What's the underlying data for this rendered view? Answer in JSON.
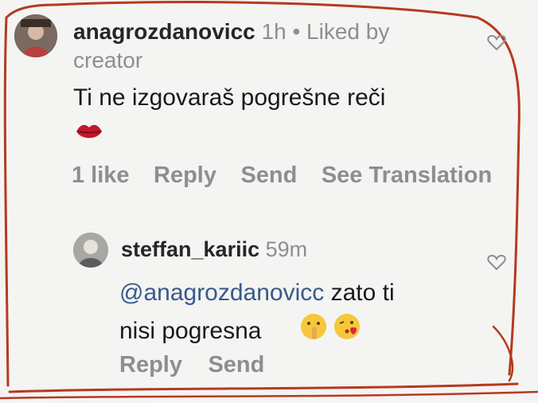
{
  "comments": [
    {
      "username": "anagrozdanovicc",
      "time": "1h",
      "separator": "•",
      "liked_by": "Liked by",
      "liked_by_line2": "creator",
      "text": "Ti ne izgovaraš pogrešne reči",
      "emoji": "lips",
      "likes": "1 like",
      "reply": "Reply",
      "send": "Send",
      "translate": "See Translation"
    },
    {
      "username": "steffan_kariic",
      "time": "59m",
      "mention": "@anagrozdanovicc",
      "text_line1_rest": " zato ti",
      "text_line2": "nisi pogresna",
      "emojis": [
        "shushing-face",
        "face-blowing-kiss"
      ],
      "reply": "Reply",
      "send": "Send"
    }
  ],
  "annotation_color": "#b53a1f"
}
